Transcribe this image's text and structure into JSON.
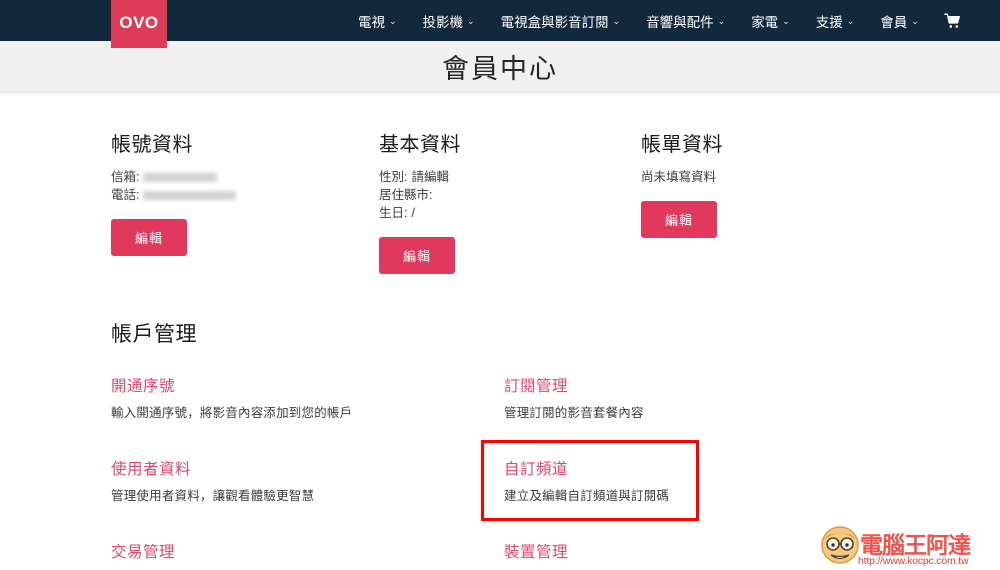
{
  "navbar": {
    "logo_text": "OVO",
    "items": [
      {
        "label": "電視",
        "has_caret": true
      },
      {
        "label": "投影機",
        "has_caret": true
      },
      {
        "label": "電視盒與影音訂閱",
        "has_caret": true
      },
      {
        "label": "音響與配件",
        "has_caret": true
      },
      {
        "label": "家電",
        "has_caret": true
      },
      {
        "label": "支援",
        "has_caret": true
      },
      {
        "label": "會員",
        "has_caret": true
      }
    ],
    "caret": "⌄",
    "cart_icon": "cart-icon",
    "bg_color": "#12283c",
    "logo_color": "#dd3b56"
  },
  "header": {
    "page_title": "會員中心",
    "band_color": "#f0f0f0"
  },
  "cards": [
    {
      "title": "帳號資料",
      "lines": [
        {
          "label": "信箱:",
          "value": "",
          "redacted": true
        },
        {
          "label": "電話:",
          "value": "",
          "redacted": true
        }
      ],
      "button": "編輯"
    },
    {
      "title": "基本資料",
      "lines": [
        {
          "label": "性別:",
          "value": "請編輯",
          "redacted": false
        },
        {
          "label": "居住縣市:",
          "value": "",
          "redacted": false
        },
        {
          "label": "生日:",
          "value": "/",
          "redacted": false
        }
      ],
      "button": "編輯"
    },
    {
      "title": "帳單資料",
      "lines": [
        {
          "label": "尚未填寫資料",
          "value": "",
          "redacted": false
        }
      ],
      "button": "編輯"
    }
  ],
  "account_management": {
    "section_title": "帳戶管理",
    "accent_color": "#e0476a",
    "highlight_color": "#ff0000",
    "items": [
      {
        "link": "開通序號",
        "desc": "輸入開通序號，將影音內容添加到您的帳戶",
        "highlighted": false
      },
      {
        "link": "訂閱管理",
        "desc": "管理訂閱的影音套餐內容",
        "highlighted": false
      },
      {
        "link": "使用者資料",
        "desc": "管理使用者資料，讓觀看體驗更智慧",
        "highlighted": false
      },
      {
        "link": "自訂頻道",
        "desc": "建立及編輯自訂頻道與訂閱碼",
        "highlighted": true
      },
      {
        "link": "交易管理",
        "desc": "",
        "highlighted": false
      },
      {
        "link": "裝置管理",
        "desc": "",
        "highlighted": false
      }
    ]
  },
  "watermark": {
    "brand_cn": "電腦王阿達",
    "url": "http://www.kocpc.com.tw",
    "color": "#e8342a"
  }
}
